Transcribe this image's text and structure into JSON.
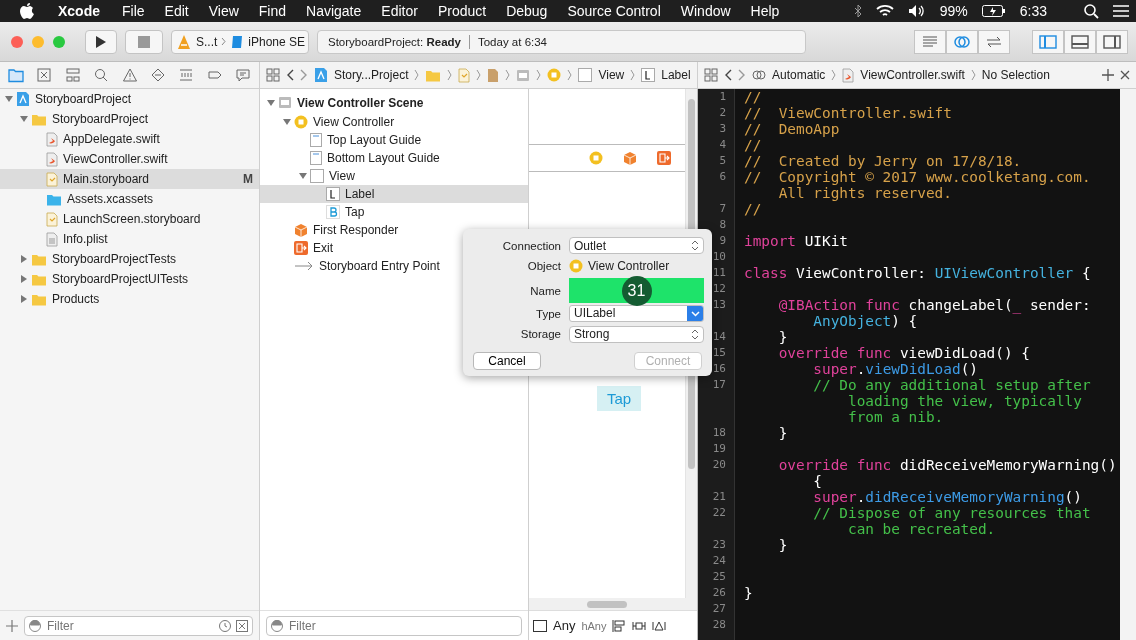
{
  "menu_bar": {
    "app": "Xcode",
    "items": [
      "File",
      "Edit",
      "View",
      "Find",
      "Navigate",
      "Editor",
      "Product",
      "Debug",
      "Source Control",
      "Window",
      "Help"
    ],
    "battery": "99%",
    "time": "6:33"
  },
  "toolbar": {
    "scheme": "S...t",
    "device": "iPhone SE",
    "status": "StoryboardProject: **Ready**",
    "status_time": "Today at 6:34"
  },
  "jump_bar": {
    "items": [
      "Story...Project",
      "View",
      "Label"
    ]
  },
  "assistant_bar": {
    "mode": "Automatic",
    "file": "ViewController.swift",
    "selection": "No Selection"
  },
  "navigator": {
    "filter_placeholder": "Filter",
    "items": [
      {
        "label": "StoryboardProject",
        "kind": "project",
        "expanded": true,
        "selected": false,
        "children": [
          {
            "label": "StoryboardProject",
            "kind": "folder",
            "expanded": true,
            "selected": false,
            "children": [
              {
                "label": "AppDelegate.swift",
                "kind": "swift",
                "selected": false
              },
              {
                "label": "ViewController.swift",
                "kind": "swift",
                "selected": false
              },
              {
                "label": "Main.storyboard",
                "kind": "storyboard",
                "selected": true,
                "badge": "M"
              },
              {
                "label": "Assets.xcassets",
                "kind": "assets",
                "selected": false
              },
              {
                "label": "LaunchScreen.storyboard",
                "kind": "storyboard",
                "selected": false
              },
              {
                "label": "Info.plist",
                "kind": "plist",
                "selected": false
              }
            ]
          },
          {
            "label": "StoryboardProjectTests",
            "kind": "folder",
            "expanded": false,
            "selected": false
          },
          {
            "label": "StoryboardProjectUITests",
            "kind": "folder",
            "expanded": false,
            "selected": false
          },
          {
            "label": "Products",
            "kind": "folder",
            "expanded": false,
            "selected": false
          }
        ]
      }
    ]
  },
  "outline": {
    "filter_placeholder": "Filter",
    "items": [
      {
        "label": "View Controller Scene",
        "kind": "scene",
        "expanded": true,
        "selected": false,
        "children": [
          {
            "label": "View Controller",
            "kind": "controller",
            "expanded": true,
            "selected": false,
            "children": [
              {
                "label": "Top Layout Guide",
                "kind": "guide",
                "selected": false
              },
              {
                "label": "Bottom Layout Guide",
                "kind": "guide",
                "selected": false
              },
              {
                "label": "View",
                "kind": "view",
                "expanded": true,
                "selected": false,
                "children": [
                  {
                    "label": "Label",
                    "kind": "label",
                    "selected": true
                  },
                  {
                    "label": "Tap",
                    "kind": "button",
                    "selected": false
                  }
                ]
              }
            ]
          },
          {
            "label": "First Responder",
            "kind": "responder",
            "selected": false
          },
          {
            "label": "Exit",
            "kind": "exit",
            "selected": false
          },
          {
            "label": "Storyboard Entry Point",
            "kind": "entry",
            "selected": false
          }
        ]
      }
    ]
  },
  "canvas": {
    "button": "Tap",
    "size_class_width": "Any",
    "size_class_height": "hAny"
  },
  "connection_dialog": {
    "labels": [
      "Connection",
      "Object",
      "Name",
      "Type",
      "Storage"
    ],
    "connection": "Outlet",
    "object": "View Controller",
    "name_highlighted": true,
    "step_badge": "31",
    "type": "UILabel",
    "storage": "Strong",
    "cancel": "Cancel",
    "connect": "Connect",
    "connect_disabled": true
  },
  "code": [
    {
      "number": "1",
      "tokens": [
        {
          "kind": "doc",
          "text": "//"
        }
      ]
    },
    {
      "number": "2",
      "tokens": [
        {
          "kind": "doc",
          "text": "//  ViewController.swift"
        }
      ]
    },
    {
      "number": "3",
      "tokens": [
        {
          "kind": "doc",
          "text": "//  DemoApp"
        }
      ]
    },
    {
      "number": "4",
      "tokens": [
        {
          "kind": "doc",
          "text": "//"
        }
      ]
    },
    {
      "number": "5",
      "tokens": [
        {
          "kind": "doc",
          "text": "//  Created by Jerry on 17/8/18."
        }
      ]
    },
    {
      "number": "6",
      "tokens": [
        {
          "kind": "doc",
          "text": "//  Copyright © 2017 www.coolketang.com."
        }
      ]
    },
    {
      "tokens": [
        {
          "kind": "doc",
          "text": "    All rights reserved."
        }
      ]
    },
    {
      "number": "7",
      "tokens": [
        {
          "kind": "doc",
          "text": "//"
        }
      ]
    },
    {
      "number": "8"
    },
    {
      "number": "9",
      "tokens": [
        {
          "kind": "keyword",
          "text": "import"
        },
        {
          "kind": "plain",
          "text": " UIKit"
        }
      ]
    },
    {
      "number": "10"
    },
    {
      "number": "11",
      "tokens": [
        {
          "kind": "keyword",
          "text": "class"
        },
        {
          "kind": "plain",
          "text": " ViewController: "
        },
        {
          "kind": "type",
          "text": "UIViewController"
        },
        {
          "kind": "plain",
          "text": " {"
        }
      ]
    },
    {
      "number": "12"
    },
    {
      "number": "13",
      "tokens": [
        {
          "kind": "keyword",
          "text": "    @IBAction func"
        },
        {
          "kind": "plain",
          "text": " changeLabel("
        },
        {
          "kind": "keyword",
          "text": "_"
        },
        {
          "kind": "plain",
          "text": " sender:"
        }
      ]
    },
    {
      "tokens": [
        {
          "kind": "type",
          "text": "        AnyObject"
        },
        {
          "kind": "plain",
          "text": ") {"
        }
      ]
    },
    {
      "number": "14",
      "tokens": [
        {
          "kind": "plain",
          "text": "    }"
        }
      ]
    },
    {
      "number": "15",
      "tokens": [
        {
          "kind": "keyword",
          "text": "    override func"
        },
        {
          "kind": "plain",
          "text": " viewDidLoad() {"
        }
      ]
    },
    {
      "number": "16",
      "tokens": [
        {
          "kind": "keyword",
          "text": "        super"
        },
        {
          "kind": "plain",
          "text": "."
        },
        {
          "kind": "call",
          "text": "viewDidLoad"
        },
        {
          "kind": "plain",
          "text": "()"
        }
      ]
    },
    {
      "number": "17",
      "tokens": [
        {
          "kind": "comment",
          "text": "        // Do any additional setup after"
        }
      ]
    },
    {
      "tokens": [
        {
          "kind": "comment",
          "text": "            loading the view, typically"
        }
      ]
    },
    {
      "tokens": [
        {
          "kind": "comment",
          "text": "            from a nib."
        }
      ]
    },
    {
      "number": "18",
      "tokens": [
        {
          "kind": "plain",
          "text": "    }"
        }
      ]
    },
    {
      "number": "19"
    },
    {
      "number": "20",
      "tokens": [
        {
          "kind": "keyword",
          "text": "    override func"
        },
        {
          "kind": "plain",
          "text": " didReceiveMemoryWarning()"
        }
      ]
    },
    {
      "tokens": [
        {
          "kind": "plain",
          "text": "        {"
        }
      ]
    },
    {
      "number": "21",
      "tokens": [
        {
          "kind": "keyword",
          "text": "        super"
        },
        {
          "kind": "plain",
          "text": "."
        },
        {
          "kind": "call",
          "text": "didReceiveMemoryWarning"
        },
        {
          "kind": "plain",
          "text": "()"
        }
      ]
    },
    {
      "number": "22",
      "tokens": [
        {
          "kind": "comment",
          "text": "        // Dispose of any resources that"
        }
      ]
    },
    {
      "tokens": [
        {
          "kind": "comment",
          "text": "            can be recreated."
        }
      ]
    },
    {
      "number": "23",
      "tokens": [
        {
          "kind": "plain",
          "text": "    }"
        }
      ]
    },
    {
      "number": "24"
    },
    {
      "number": "25"
    },
    {
      "number": "26",
      "tokens": [
        {
          "kind": "plain",
          "text": "}"
        }
      ]
    },
    {
      "number": "27"
    },
    {
      "number": "28"
    }
  ]
}
